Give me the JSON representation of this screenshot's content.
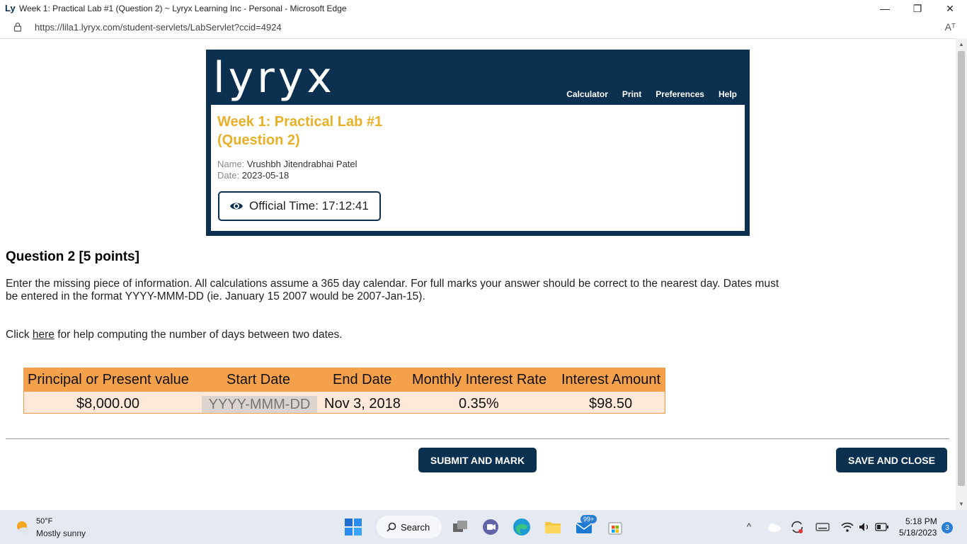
{
  "window": {
    "logo_text": "Ly",
    "title": "Week 1: Practical Lab #1 (Question 2) ~ Lyryx Learning Inc - Personal - Microsoft Edge",
    "minimize": "—",
    "restore": "❐",
    "close": "✕"
  },
  "browser": {
    "url": "https://lila1.lyryx.com/student-servlets/LabServlet?ccid=4924",
    "read_aloud": "Aᵀ"
  },
  "header": {
    "logo": "lyryx",
    "nav": [
      "Calculator",
      "Print",
      "Preferences",
      "Help"
    ],
    "lab_title": "Week 1: Practical Lab #1 (Question 2)",
    "name_label": "Name:",
    "name_value": "Vrushbh Jitendrabhai Patel",
    "date_label": "Date:",
    "date_value": "2023-05-18",
    "official_time": "Official Time: 17:12:41"
  },
  "question": {
    "title": "Question 2 [5 points]",
    "text": "Enter the missing piece of information. All calculations assume a 365 day calendar. For full marks your answer should be correct to the nearest day. Dates must be entered in the format YYYY-MMM-DD (ie. January 15 2007 would be 2007-Jan-15).",
    "help_prefix": "Click ",
    "help_link": "here",
    "help_suffix": " for help computing the number of days between two dates."
  },
  "table": {
    "headers": [
      "Principal or Present value",
      "Start Date",
      "End Date",
      "Monthly Interest Rate",
      "Interest Amount"
    ],
    "principal": "$8,000.00",
    "start_placeholder": "YYYY-MMM-DD",
    "end_date": "Nov 3, 2018",
    "rate": "0.35%",
    "interest": "$98.50"
  },
  "actions": {
    "submit": "SUBMIT AND MARK",
    "save": "SAVE AND CLOSE"
  },
  "taskbar": {
    "temp": "50°F",
    "condition": "Mostly sunny",
    "search": "Search",
    "mail_badge": "99+",
    "time": "5:18 PM",
    "date": "5/18/2023",
    "notifications": "3"
  },
  "colors": {
    "brand_navy": "#0c3050",
    "title_gold": "#e8b027",
    "table_header": "#f5a04b",
    "table_row": "#fde8d9"
  }
}
